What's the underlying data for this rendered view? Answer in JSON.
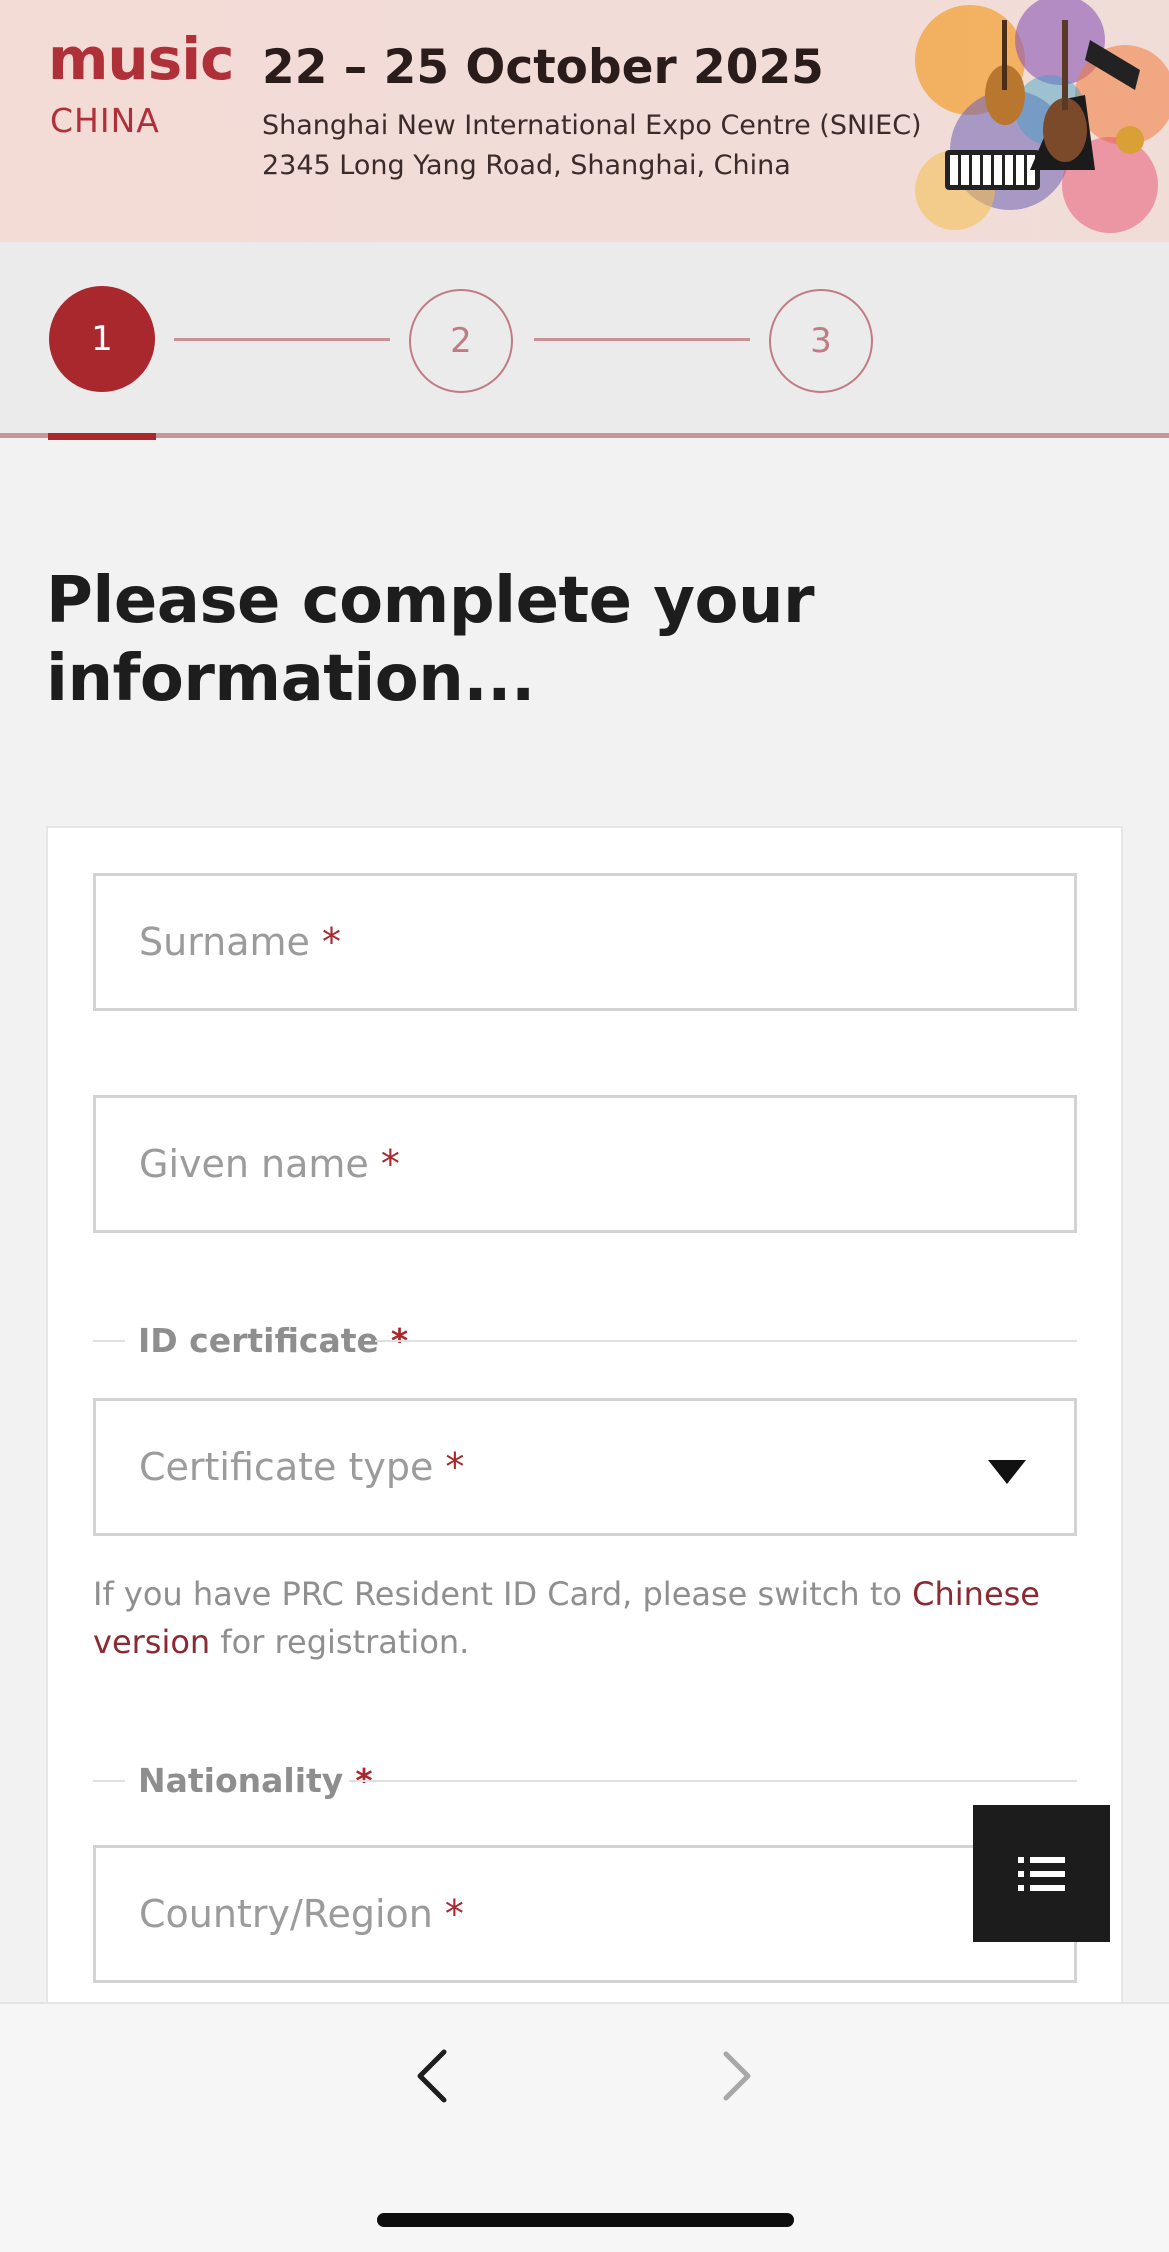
{
  "banner": {
    "logo_top": "music",
    "logo_bottom": "CHINA",
    "date": "22 – 25 October 2025",
    "venue": "Shanghai New International Expo Centre (SNIEC)",
    "address": "2345 Long Yang Road, Shanghai, China",
    "art_icon": "musical-instruments-illustration"
  },
  "stepper": {
    "steps": [
      "1",
      "2",
      "3"
    ],
    "current_step": 1
  },
  "page": {
    "title_line1": "Please complete your",
    "title_line2": "information..."
  },
  "form": {
    "surname": {
      "placeholder": "Surname",
      "required_mark": "*"
    },
    "given_name": {
      "placeholder": "Given name",
      "required_mark": "*"
    },
    "id_section": {
      "label": "ID certificate",
      "required_mark": "*"
    },
    "certificate_type": {
      "placeholder": "Certificate type",
      "required_mark": "*"
    },
    "hint": {
      "prefix": "If you have PRC Resident ID Card, please switch to ",
      "link_text": "Chinese version",
      "suffix": " for registration."
    },
    "nationality_section": {
      "label": "Nationality",
      "required_mark": "*"
    },
    "country_region": {
      "placeholder": "Country/Region",
      "required_mark": "*"
    }
  },
  "floating_menu": {
    "icon": "list-menu-icon"
  },
  "bottom_nav": {
    "back_icon": "chevron-left-icon",
    "forward_icon": "chevron-right-icon"
  },
  "colors": {
    "accent": "#a8282e",
    "banner_bg": "#f3dbd6",
    "page_bg": "#f2f2f2",
    "placeholder": "#9b9b9b"
  }
}
